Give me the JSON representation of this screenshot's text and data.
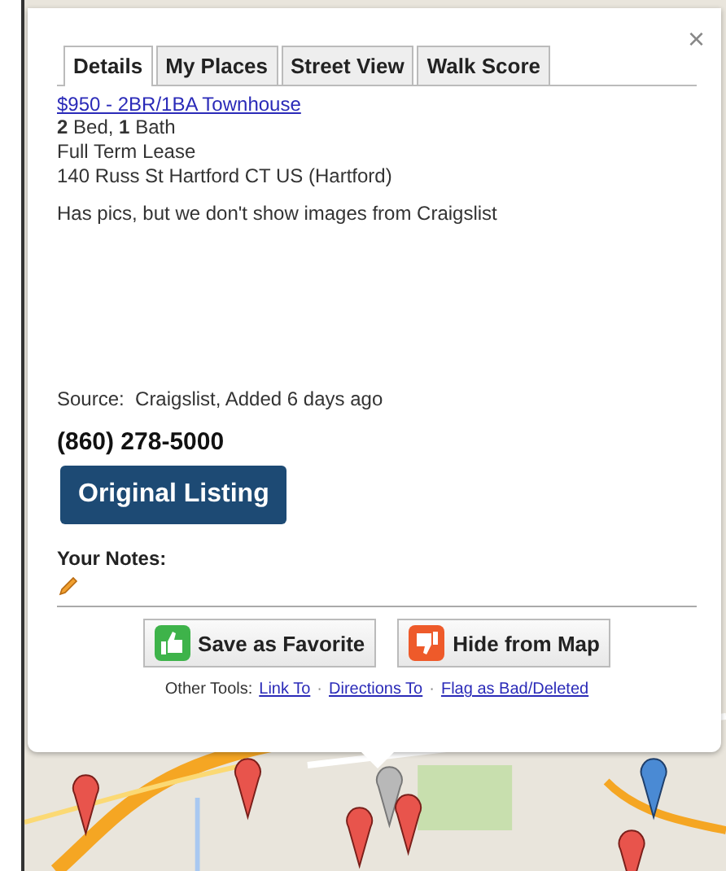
{
  "tabs": [
    {
      "label": "Details",
      "selected": true
    },
    {
      "label": "My Places",
      "selected": false
    },
    {
      "label": "Street View",
      "selected": false
    },
    {
      "label": "Walk Score",
      "selected": false
    }
  ],
  "close": "×",
  "listing": {
    "title": "$950 - 2BR/1BA Townhouse",
    "beds": "**2** Bed, **1** Bath",
    "lease": "Full Term Lease",
    "address": "140 Russ St Hartford CT US (Hartford)",
    "note": "Has pics, but we don't show images from Craigslist",
    "source": "Source:  Craigslist, Added 6 days ago",
    "phone": "(860) 278-5000"
  },
  "original_button": "Original Listing",
  "notes_label": "Your Notes:",
  "actions": [
    {
      "label": "Save as Favorite",
      "kind": "favorite"
    },
    {
      "label": "Hide from Map",
      "kind": "hide"
    }
  ],
  "other_tools": {
    "label": "Other Tools:",
    "separator": "·",
    "links": [
      "Link To",
      "Directions To",
      "Flag as Bad/Deleted"
    ]
  }
}
